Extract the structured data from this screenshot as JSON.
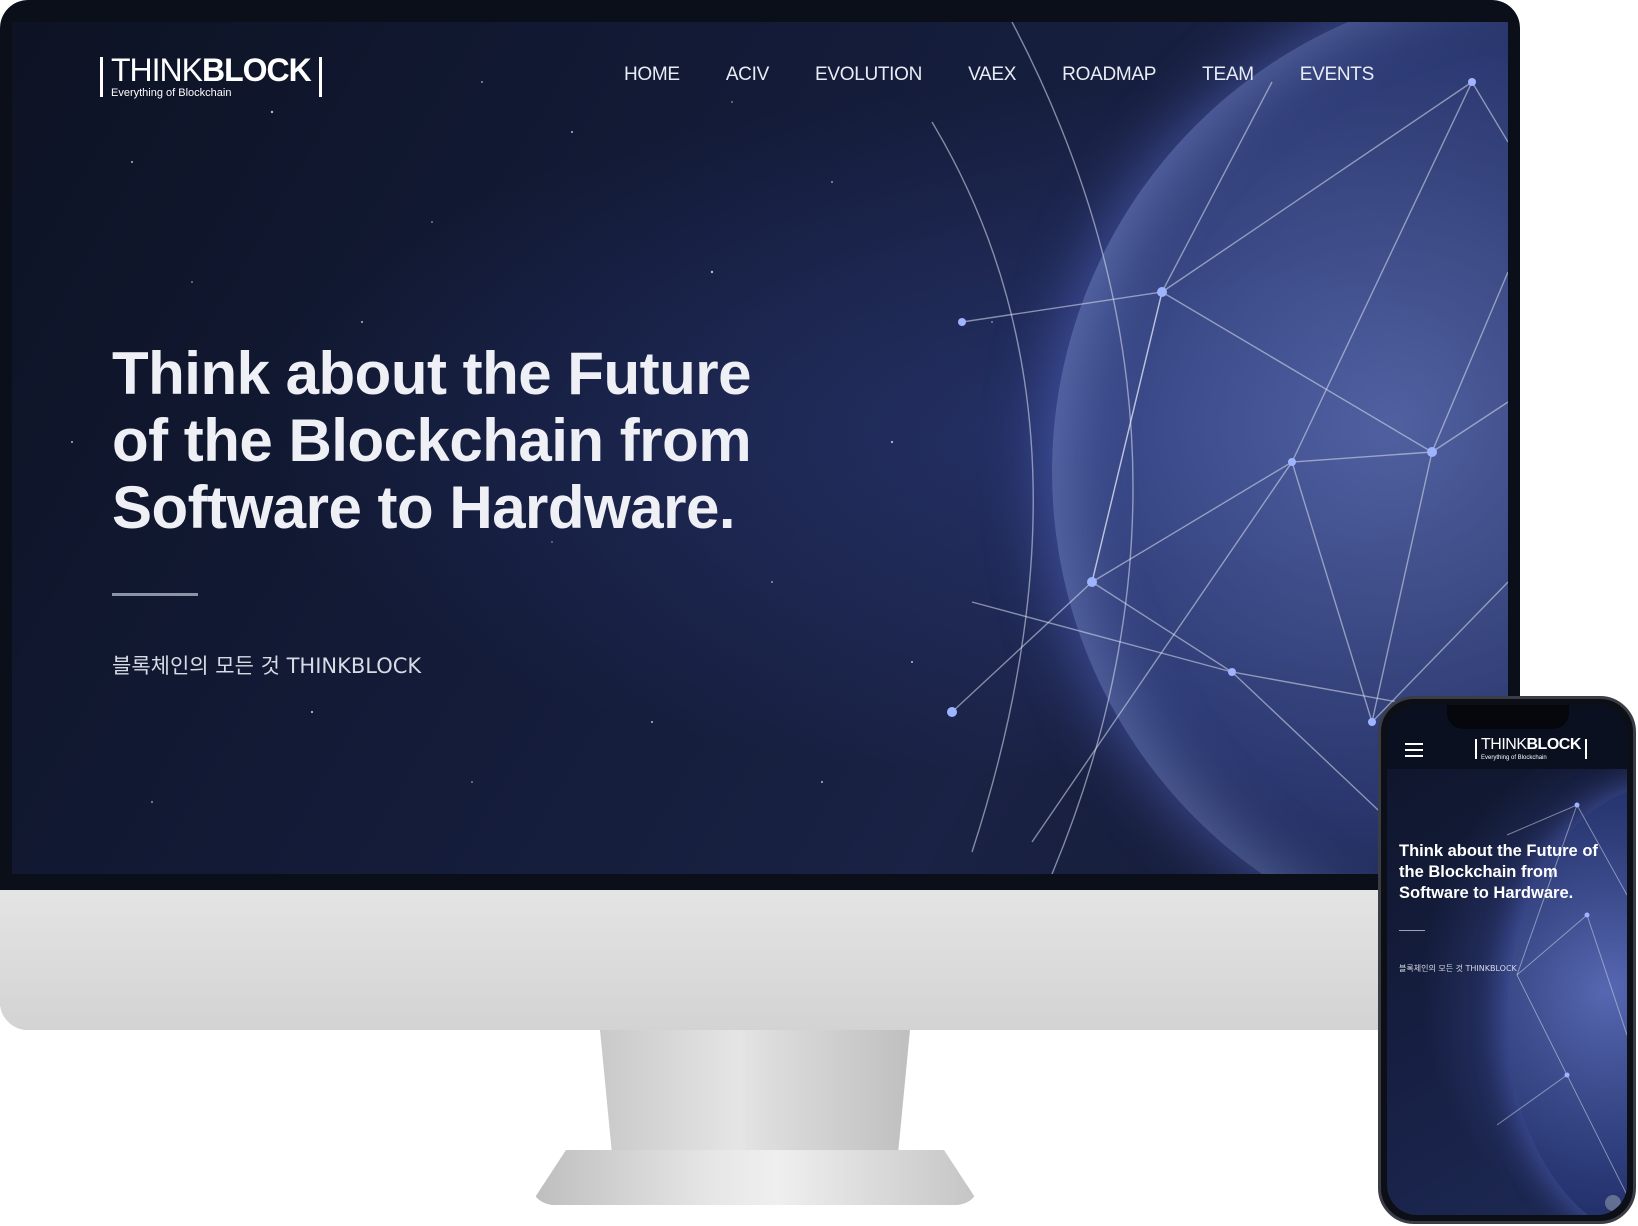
{
  "brand": {
    "logo_thin": "THINK",
    "logo_bold": "BLOCK",
    "tagline": "Everything of Blockchain"
  },
  "nav": {
    "items": [
      {
        "label": "HOME"
      },
      {
        "label": "ACIV"
      },
      {
        "label": "EVOLUTION"
      },
      {
        "label": "VAEX"
      },
      {
        "label": "ROADMAP"
      },
      {
        "label": "TEAM"
      },
      {
        "label": "EVENTS"
      }
    ]
  },
  "hero": {
    "title": "Think about the Future\nof the Blockchain from\nSoftware to Hardware.",
    "subtitle": "블록체인의 모든 것 THINKBLOCK"
  },
  "mobile": {
    "title": "Think about the Future of\nthe Blockchain from\nSoftware to Hardware.",
    "subtitle": "블록체인의 모든 것 THINKBLOCK"
  },
  "colors": {
    "background": "#131b38",
    "text": "#eef0f5",
    "accent_glow": "#5a6ff0"
  },
  "icons": {
    "menu": "hamburger-icon",
    "scroll_top": "arrow-up-icon"
  }
}
